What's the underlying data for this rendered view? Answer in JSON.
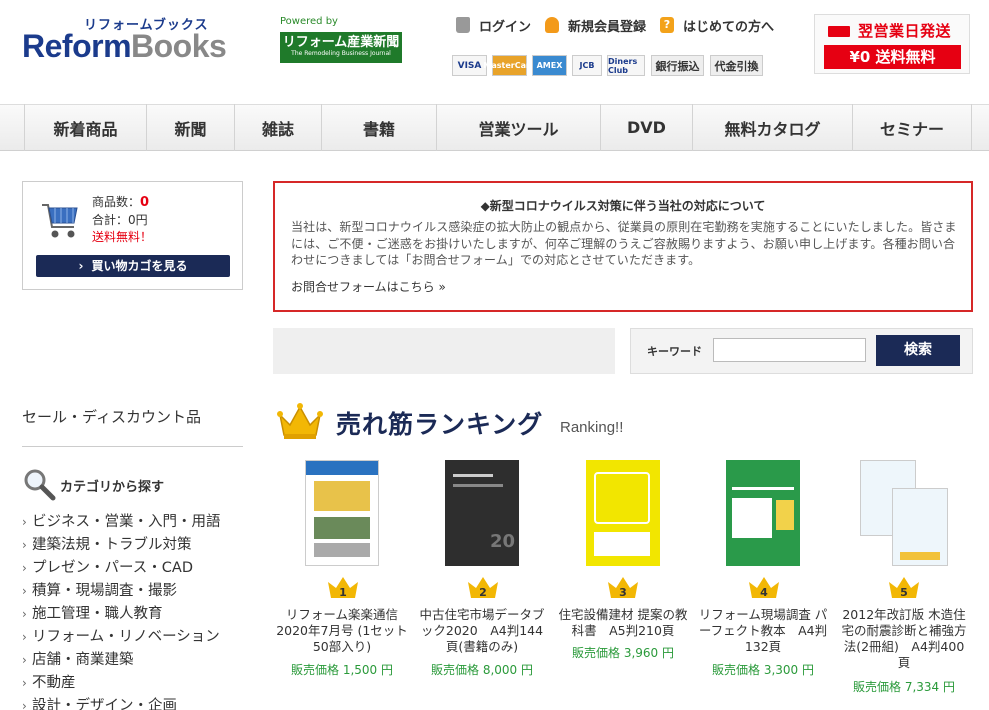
{
  "header": {
    "logo_sub": "リフォームブックス",
    "logo_main_1": "Reform",
    "logo_main_2": "Books",
    "powered": "Powered by",
    "newspaper_title": "リフォーム産業新聞",
    "newspaper_sub": "The Remodeling Business Journal",
    "links": {
      "login": "ログイン",
      "register": "新規会員登録",
      "first": "はじめての方へ"
    },
    "payments": [
      "VISA",
      "MasterCard",
      "AMEX",
      "JCB",
      "Diners Club",
      "銀行振込",
      "代金引換"
    ],
    "promo_line1": "翌営業日発送",
    "promo_line2": "¥0 送料無料"
  },
  "nav": [
    "新着商品",
    "新聞",
    "雑誌",
    "書籍",
    "営業ツール",
    "DVD",
    "無料カタログ",
    "セミナー"
  ],
  "cart": {
    "count_label": "商品数：",
    "count_value": "0",
    "total_label": "合計：0円",
    "free_shipping": "送料無料！",
    "button": "買い物カゴを見る"
  },
  "notice": {
    "title": "◆新型コロナウイルス対策に伴う当社の対応について",
    "body": "当社は、新型コロナウイルス感染症の拡大防止の観点から、従業員の原則在宅勤務を実施することにいたしました。皆さまには、ご不便・ご迷惑をお掛けいたしますが、何卒ご理解のうえご容赦賜りますよう、お願い申し上げます。各種お問い合わせにつきましては「お問合せフォーム」での対応とさせていただきます。",
    "link": "お問合せフォームはこちら »"
  },
  "search": {
    "label": "キーワード",
    "value": "",
    "button": "検索"
  },
  "sidebar": {
    "sale": "セール・ディスカウント品",
    "category_head": "カテゴリから探す",
    "categories": [
      "ビジネス・営業・入門・用語",
      "建築法規・トラブル対策",
      "プレゼン・パース・CAD",
      "積算・現場調査・撮影",
      "施工管理・職人教育",
      "リフォーム・リノベーション",
      "店舗・商業建築",
      "不動産",
      "設計・デザイン・企画"
    ]
  },
  "ranking": {
    "title": "売れ筋ランキング",
    "subtitle": "Ranking!!",
    "items": [
      {
        "rank": "1",
        "name_lines": [
          "リフォーム楽楽通信",
          "2020年7月号 (1セット",
          "50部入り)"
        ],
        "price": "販売価格 1,500 円"
      },
      {
        "rank": "2",
        "name_lines": [
          "中古住宅市場データブ",
          "ック2020　A4判144",
          "頁(書籍のみ)"
        ],
        "price": "販売価格 8,000 円"
      },
      {
        "rank": "3",
        "name_lines": [
          "住宅設備建材 提案の教",
          "科書　A5判210頁"
        ],
        "price": "販売価格 3,960 円"
      },
      {
        "rank": "4",
        "name_lines": [
          "リフォーム現場調査 パ",
          "ーフェクト教本　A4判",
          "132頁"
        ],
        "price": "販売価格 3,300 円"
      },
      {
        "rank": "5",
        "name_lines": [
          "2012年改訂版 木造住",
          "宅の耐震診断と補強方",
          "法(2冊組)　A4判400",
          "頁"
        ],
        "price": "販売価格 7,334 円"
      }
    ]
  },
  "colors": {
    "navy": "#1b2a56",
    "red": "#e60012",
    "green_price": "#2a9a3a",
    "notice_border": "#d62828"
  }
}
